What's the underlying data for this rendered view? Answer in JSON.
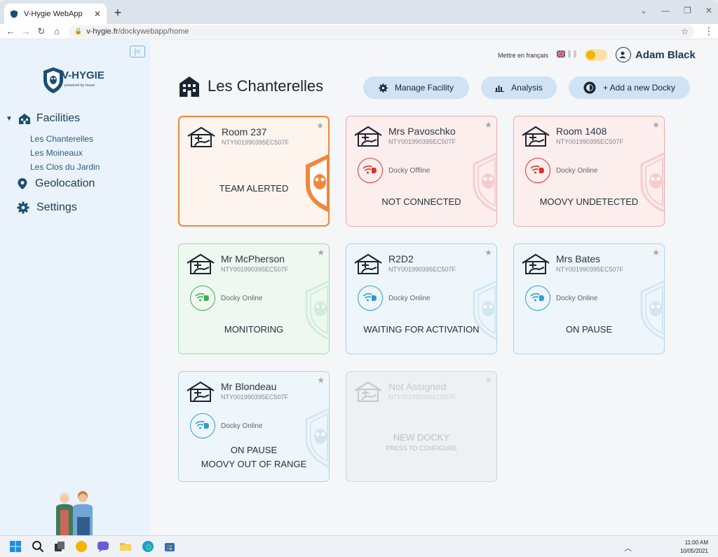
{
  "browser": {
    "tab_title": "V-Hygie WebApp",
    "url_domain": "v-hygie.fr",
    "url_path": "/dockywebapp/home"
  },
  "sidebar": {
    "logo_text": "V-HYGIE",
    "logo_tagline": "powered by touwi",
    "nav": {
      "facilities": "Facilities",
      "geolocation": "Geolocation",
      "settings": "Settings"
    },
    "facility_items": [
      "Les Chanterelles",
      "Les Moineaux",
      "Les Clos du Jardin"
    ]
  },
  "header": {
    "language_link": "Mettre en français",
    "user_name": "Adam Black",
    "page_title": "Les Chanterelles",
    "buttons": {
      "manage": "Manage Facility",
      "analysis": "Analysis",
      "add": "+  Add a new Docky"
    }
  },
  "colors": {
    "alert": "#f0873b",
    "offline": "#f2a9a9",
    "online_green": "#9edcaf",
    "online_blue": "#a8d3ea",
    "disabled": "#d0d4d8",
    "accent": "#1b4f72"
  },
  "cards": [
    {
      "name": "Room 237",
      "serial": "NTY001990395EC507F",
      "connection": "",
      "status": "TEAM ALERTED",
      "status2": ""
    },
    {
      "name": "Mrs Pavoschko",
      "serial": "NTY001990395EC507F",
      "connection": "Docky Offline",
      "status": "NOT CONNECTED",
      "status2": ""
    },
    {
      "name": "Room 1408",
      "serial": "NTY001990395EC507F",
      "connection": "Docky Online",
      "status": "MOOVY UNDETECTED",
      "status2": ""
    },
    {
      "name": "Mr McPherson",
      "serial": "NTY001990395EC507F",
      "connection": "Docky Online",
      "status": "MONITORING",
      "status2": ""
    },
    {
      "name": "R2D2",
      "serial": "NTY001990395EC507F",
      "connection": "Docky Online",
      "status": "WAITING FOR ACTIVATION",
      "status2": ""
    },
    {
      "name": "Mrs Bates",
      "serial": "NTY001990395EC507F",
      "connection": "Docky Online",
      "status": "ON PAUSE",
      "status2": ""
    },
    {
      "name": "Mr Blondeau",
      "serial": "NTY001990395EC507F",
      "connection": "Docky Online",
      "status": "ON PAUSE",
      "status2": "MOOVY OUT OF RANGE"
    },
    {
      "name": "Not Assigned",
      "serial": "NTY001990395EC507F",
      "connection": "",
      "status": "NEW DOCKY",
      "status2": "PRESS TO CONFIGURE"
    }
  ],
  "taskbar": {
    "time": "11:00 AM",
    "date": "10/05/2021"
  }
}
